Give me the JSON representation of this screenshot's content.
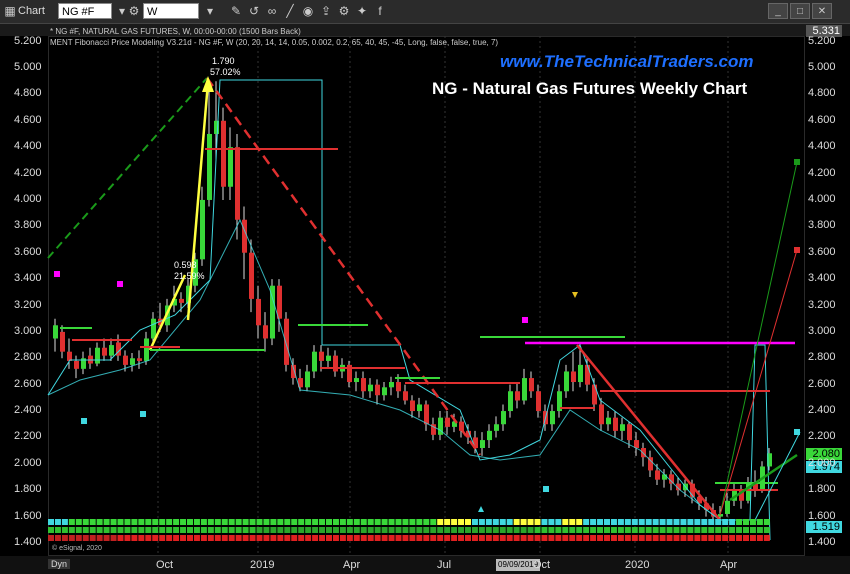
{
  "toolbar": {
    "app_label": "Chart",
    "symbol": "NG #F",
    "interval": "W"
  },
  "header": {
    "line1": "* NG #F, NATURAL GAS FUTURES, W, 00:00-00:00 (1500 Bars Back)",
    "line2": "MENT Fibonacci Price Modeling V3.21d - NG #F, W (20, 20, 14, 14, 0.05, 0.002, 0.2, 65, 40, 45, -45, Long, false, false, true, 7)"
  },
  "website": "www.TheTechnicalTraders.com",
  "title": "NG - Natural Gas Futures Weekly Chart",
  "axis": {
    "top_value": "5.331",
    "left_ticks": [
      "5.200",
      "5.000",
      "4.800",
      "4.600",
      "4.400",
      "4.200",
      "4.000",
      "3.800",
      "3.600",
      "3.400",
      "3.200",
      "3.000",
      "2.800",
      "2.600",
      "2.400",
      "2.200",
      "2.000",
      "1.800",
      "1.600",
      "1.400"
    ],
    "right_ticks": [
      "5.200",
      "5.000",
      "4.800",
      "4.600",
      "4.400",
      "4.200",
      "4.000",
      "3.800",
      "3.600",
      "3.400",
      "3.200",
      "3.000",
      "2.800",
      "2.600",
      "2.400",
      "2.200",
      "2.000",
      "1.800",
      "1.600",
      "1.400"
    ],
    "x_ticks": [
      "Oct",
      "2019",
      "Apr",
      "Jul",
      "Oct",
      "2020",
      "Apr"
    ]
  },
  "price_labels": {
    "top": "5.331",
    "last_green": "2.080",
    "last_cyan": "1.974",
    "low_cyan": "1.519"
  },
  "annotations": {
    "move1_pts": "1.790",
    "move1_pct": "57.02%",
    "move2_pts": "0.598",
    "move2_pct": "21.59%"
  },
  "footer": {
    "copyright": "© eSignal, 2020",
    "dyn": "Dyn",
    "date_cursor": "09/09/2019"
  },
  "colors": {
    "up": "#39d839",
    "down": "#e03030",
    "cyan": "#40d8e0",
    "magenta": "#ff00ff",
    "yellow": "#ffff40",
    "website_blue": "#1e6fff"
  },
  "chart_data": {
    "type": "candlestick",
    "ylim": [
      1.4,
      5.331
    ],
    "x_ticks": [
      "Oct",
      "2019",
      "Apr",
      "Jul",
      "Oct",
      "2020",
      "Apr"
    ]
  }
}
